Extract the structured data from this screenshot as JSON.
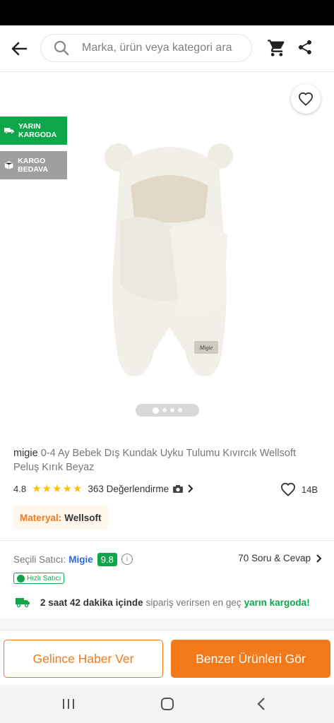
{
  "header": {
    "search_placeholder": "Marka, ürün veya kategori ara",
    "icons": [
      "back-arrow-icon",
      "search-icon",
      "cart-icon",
      "share-icon"
    ]
  },
  "gallery": {
    "badges": [
      {
        "label": "YARIN KARGODA",
        "color": "#0fa54a",
        "icon": "truck-icon"
      },
      {
        "label": "KARGO BEDAVA",
        "color": "#9f9f9f",
        "icon": "box-icon"
      }
    ],
    "image_count": 4,
    "active_image": 1
  },
  "product": {
    "brand": "migie",
    "name": "0-4 Ay Bebek Dış Kundak Uyku Tulumu Kıvırcık Wellsoft Peluş Kırık Beyaz",
    "rating": "4.8",
    "stars": 5,
    "reviews": "363 Değerlendirme",
    "favorites": "14B",
    "attribute": {
      "key": "Materyal:",
      "value": "Wellsoft"
    }
  },
  "seller": {
    "label": "Seçili Satıcı:",
    "name": "Migie",
    "score": "9.8",
    "qa": "70 Soru & Cevap",
    "fast_seller": "Hızlı Satıcı"
  },
  "delivery": {
    "time": "2 saat 42 dakika içinde",
    "text": "sipariş verirsen en geç",
    "highlight": "yarın kargoda!"
  },
  "actions": {
    "notify": "Gelince Haber Ver",
    "similar": "Benzer Ürünleri Gör"
  },
  "colors": {
    "accent": "#f27a1a",
    "green": "#0fa54a",
    "link": "#2b6cd9"
  }
}
